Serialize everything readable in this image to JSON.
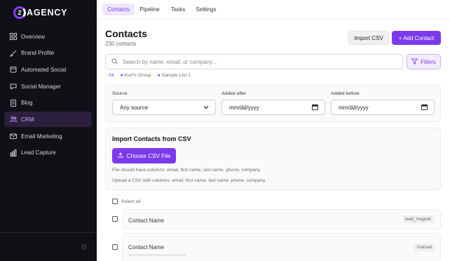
{
  "brand": {
    "logo_letter": "2",
    "name": "AGENCY"
  },
  "sidebar": {
    "items": [
      {
        "label": "Overview",
        "icon": "grid-icon",
        "active": false
      },
      {
        "label": "Brand Profile",
        "icon": "brush-icon",
        "active": false
      },
      {
        "label": "Automated Social",
        "icon": "calendar-icon",
        "active": false
      },
      {
        "label": "Social Manager",
        "icon": "chat-icon",
        "active": false
      },
      {
        "label": "Blog",
        "icon": "document-icon",
        "active": false
      },
      {
        "label": "CRM",
        "icon": "users-icon",
        "active": true
      },
      {
        "label": "Email Marketing",
        "icon": "mail-icon",
        "active": false
      },
      {
        "label": "Lead Capture",
        "icon": "bar-chart-icon",
        "active": false
      }
    ]
  },
  "tabs": [
    {
      "label": "Contacts",
      "active": true
    },
    {
      "label": "Pipeline",
      "active": false
    },
    {
      "label": "Tasks",
      "active": false
    },
    {
      "label": "Settings",
      "active": false
    }
  ],
  "page": {
    "title": "Contacts",
    "count": "230 contacts",
    "import_label": "Import CSV",
    "add_label": "+ Add Contact"
  },
  "search": {
    "placeholder": "Search by name, email, or company...",
    "value": ""
  },
  "filters_label": "Filters",
  "lists": {
    "all": "All",
    "items": [
      "Kurt's Group",
      "Sample List 1"
    ]
  },
  "filter_panel": {
    "source_label": "Source",
    "source_value": "Any source",
    "after_label": "Added after",
    "after_value": "mm/dd/yyyy",
    "before_label": "Added before",
    "before_value": "mm/dd/yyyy"
  },
  "import_panel": {
    "title": "Import Contacts from CSV",
    "button": "Choose CSV File",
    "help1": "File should have columns: email, first name, last name, phone, company",
    "help2": "Upload a CSV with columns: email, first name, last name, phone, company"
  },
  "select_all": "Select all",
  "contacts": [
    {
      "name": "Contact Name",
      "source": "lead_magnet"
    },
    {
      "name": "Contact Name",
      "source": "manual"
    }
  ],
  "colors": {
    "accent": "#7c3aed",
    "sidebar_bg": "#0f1116",
    "active_nav_bg": "#2a1f3d"
  }
}
